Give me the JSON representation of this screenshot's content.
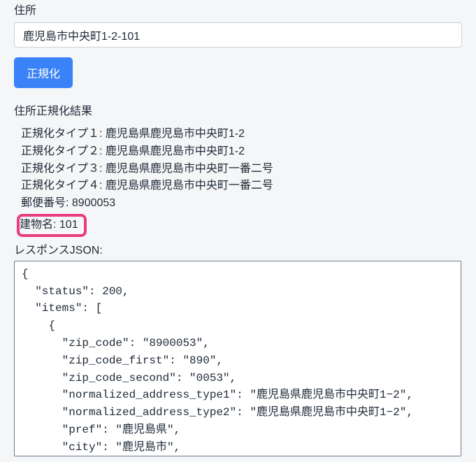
{
  "form": {
    "address_label": "住所",
    "address_value": "鹿児島市中央町1-2-101",
    "normalize_button": "正規化"
  },
  "resultHeader": "住所正規化結果",
  "results": {
    "type1_label": "正規化タイプ１:",
    "type1_value": "鹿児島県鹿児島市中央町1-2",
    "type2_label": "正規化タイプ２:",
    "type2_value": "鹿児島県鹿児島市中央町1-2",
    "type3_label": "正規化タイプ３:",
    "type3_value": "鹿児島県鹿児島市中央町一番二号",
    "type4_label": "正規化タイプ４:",
    "type4_value": "鹿児島県鹿児島市中央町一番二号",
    "zip_label": "郵便番号:",
    "zip_value": "8900053",
    "building_label": "建物名:",
    "building_value": "101"
  },
  "jsonLabel": "レスポンスJSON:",
  "responseJson": "{\n  \"status\": 200,\n  \"items\": [\n    {\n      \"zip_code\": \"8900053\",\n      \"zip_code_first\": \"890\",\n      \"zip_code_second\": \"0053\",\n      \"normalized_address_type1\": \"鹿児島県鹿児島市中央町1−2\",\n      \"normalized_address_type2\": \"鹿児島県鹿児島市中央町1−2\",\n      \"pref\": \"鹿児島県\",\n      \"city\": \"鹿児島市\","
}
